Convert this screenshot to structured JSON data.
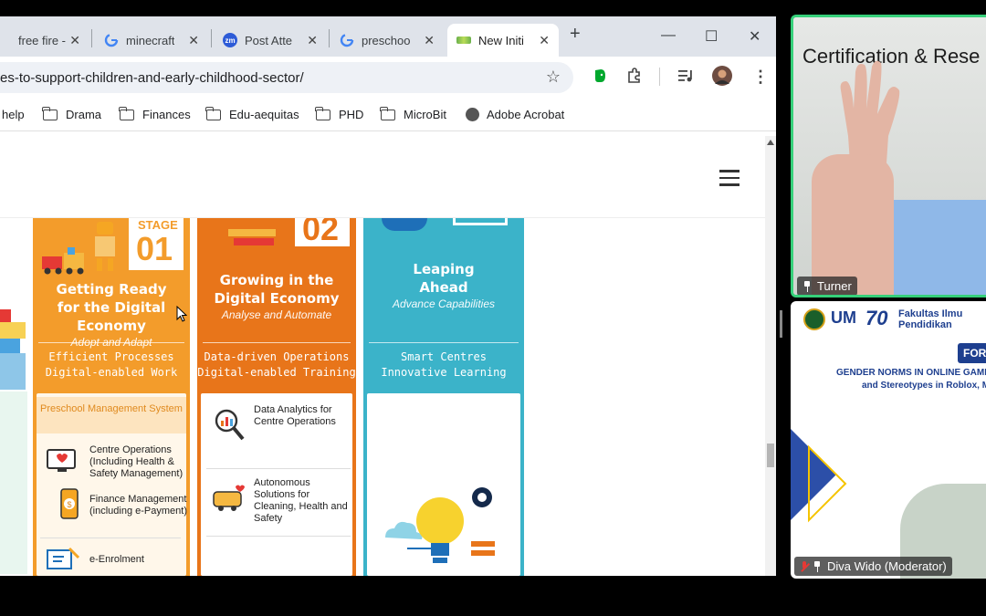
{
  "browser": {
    "tabs": [
      {
        "title": "free fire -",
        "icon": "generic-icon",
        "active": false
      },
      {
        "title": "minecraft",
        "icon": "google-icon",
        "active": false
      },
      {
        "title": "Post Atte",
        "icon": "zoom-icon",
        "icon_text": "zm",
        "active": false
      },
      {
        "title": "preschoo",
        "icon": "google-icon",
        "active": false
      },
      {
        "title": "New Initi",
        "icon": "site-icon",
        "active": true
      }
    ],
    "new_tab": "+",
    "close_glyph": "✕",
    "window_controls": {
      "minimize": "—",
      "maximize": "☐",
      "close": "✕"
    },
    "url": "es-to-support-children-and-early-childhood-sector/",
    "bookmarks": [
      {
        "label": "help",
        "icon": "none"
      },
      {
        "label": "Drama",
        "icon": "folder-icon"
      },
      {
        "label": "Finances",
        "icon": "folder-icon"
      },
      {
        "label": "Edu-aequitas",
        "icon": "folder-icon"
      },
      {
        "label": "PHD",
        "icon": "folder-icon"
      },
      {
        "label": "MicroBit",
        "icon": "folder-icon"
      },
      {
        "label": "Adobe Acrobat",
        "icon": "globe-icon"
      }
    ]
  },
  "infographic": {
    "stage1": {
      "stage_label": "STAGE",
      "stage_number": "01",
      "title": "Getting Ready for the Digital Economy",
      "subtitle": "Adopt and Adapt",
      "capabilities": [
        "Efficient Processes",
        "Digital-enabled Work"
      ],
      "system_label": "Preschool Management System",
      "items": [
        "Centre Operations (Including Health & Safety Management)",
        "Finance Management (including e-Payment)",
        "e-Enrolment"
      ]
    },
    "stage2": {
      "stage_number": "02",
      "title": "Growing in the Digital Economy",
      "subtitle": "Analyse and Automate",
      "capabilities": [
        "Data-driven Operations",
        "Digital-enabled Training"
      ],
      "items": [
        "Data Analytics for Centre Operations",
        "Autonomous Solutions for Cleaning, Health and Safety"
      ]
    },
    "stage3": {
      "title": "Leaping Ahead",
      "subtitle": "Advance Capabilities",
      "capabilities": [
        "Smart Centres",
        "Innovative Learning"
      ]
    },
    "colors": {
      "stage1": "#f39c2b",
      "stage2": "#e8751a",
      "stage3": "#3bb3c9"
    }
  },
  "meeting": {
    "video_tile": {
      "banner_text": "Certification & Rese",
      "participant_name": "Turner"
    },
    "share_tile": {
      "logo_text": "UM",
      "logo_70": "70",
      "faculty": "Fakultas Ilmu Pendidikan",
      "forum_label": "FORU",
      "headline_1": "GENDER NORMS IN ONLINE GAME",
      "headline_2": "and Stereotypes in Roblox, M",
      "participant_name": "Diva Wido (Moderator)"
    }
  }
}
